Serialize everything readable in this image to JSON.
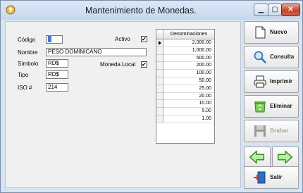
{
  "window": {
    "title": "Mantenimiento de Monedas."
  },
  "form": {
    "codigo_label": "Código",
    "codigo_value": "",
    "activo_label": "Activo",
    "activo_checked": "✔",
    "nombre_label": "Nombre",
    "nombre_value": "PESO DOMINICANO",
    "simbolo_label": "Símbolo",
    "simbolo_value": "RD$",
    "moneda_local_label": "Moneda Local",
    "moneda_local_checked": "✔",
    "tipo_label": "Tipo",
    "tipo_value": "RD$",
    "iso_label": "ISO #",
    "iso_value": "214"
  },
  "grid": {
    "header": "Denominaciones",
    "rows": [
      "2,000.00",
      "1,000.00",
      "500.00",
      "200.00",
      "100.00",
      "50.00",
      "25.00",
      "20.00",
      "10.00",
      "5.00",
      "1.00"
    ]
  },
  "actions": {
    "nuevo": "Nuevo",
    "consulta": "Consulta",
    "imprimir": "Imprimir",
    "eliminar": "Eliminar",
    "grabar": "Grabar",
    "salir": "Salir"
  }
}
